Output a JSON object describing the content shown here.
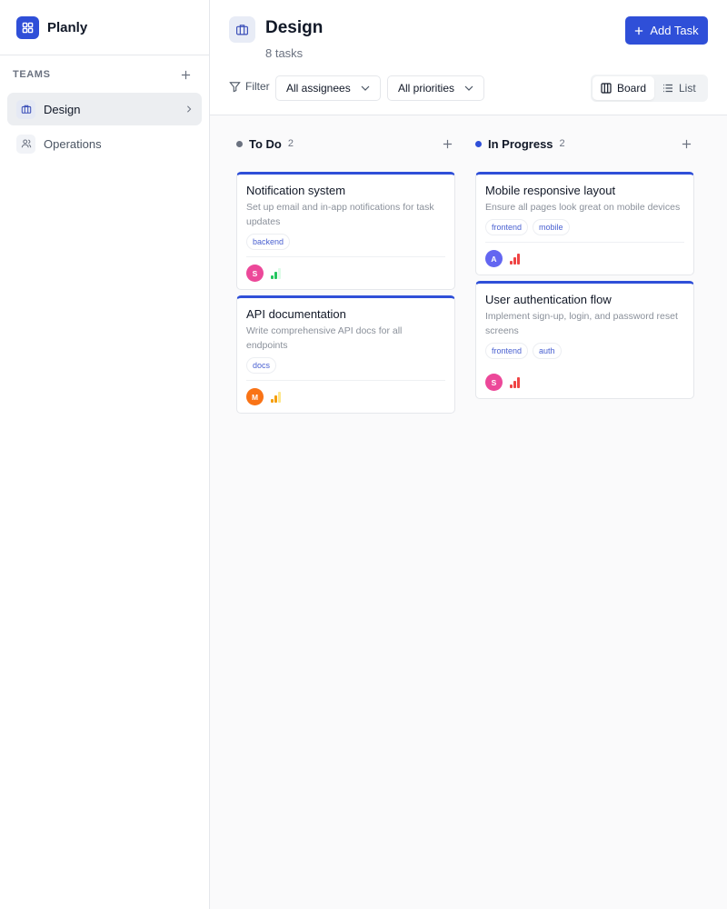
{
  "app": {
    "name": "Planly"
  },
  "sidebar": {
    "section_label": "TEAMS",
    "items": [
      {
        "label": "Design",
        "icon": "briefcase-icon",
        "active": true
      },
      {
        "label": "Operations",
        "icon": "users-icon",
        "active": false
      }
    ]
  },
  "header": {
    "title": "Design",
    "task_count": "8 tasks",
    "add_task_label": "Add Task",
    "filter_label": "Filter",
    "assignee_select": "All assignees",
    "priority_select": "All priorities",
    "views": {
      "board": "Board",
      "list": "List",
      "active": "board"
    }
  },
  "colors": {
    "accent": "#2f4fd8",
    "todo_dot": "#6b7280",
    "in_progress_dot": "#2f4fd8",
    "priority_low": "#22c55e",
    "priority_medium": "#f59e0b",
    "priority_high": "#ef4444"
  },
  "columns": [
    {
      "name": "To Do",
      "count": "2",
      "cards": [
        {
          "title": "Notification system",
          "description": "Set up email and in-app notifications for task updates",
          "tags": [
            "backend"
          ],
          "assignee_initial": "S",
          "assignee_color": "#ec4899",
          "priority": "low"
        },
        {
          "title": "API documentation",
          "description": "Write comprehensive API docs for all endpoints",
          "tags": [
            "docs"
          ],
          "assignee_initial": "M",
          "assignee_color": "#f97316",
          "priority": "medium"
        }
      ]
    },
    {
      "name": "In Progress",
      "count": "2",
      "cards": [
        {
          "title": "Mobile responsive layout",
          "description": "Ensure all pages look great on mobile devices",
          "tags": [
            "frontend",
            "mobile"
          ],
          "assignee_initial": "A",
          "assignee_color": "#6366f1",
          "priority": "high"
        },
        {
          "title": "User authentication flow",
          "description": "Implement sign-up, login, and password reset screens",
          "tags": [
            "frontend",
            "auth"
          ],
          "assignee_initial": "S",
          "assignee_color": "#ec4899",
          "priority": "high"
        }
      ]
    }
  ]
}
